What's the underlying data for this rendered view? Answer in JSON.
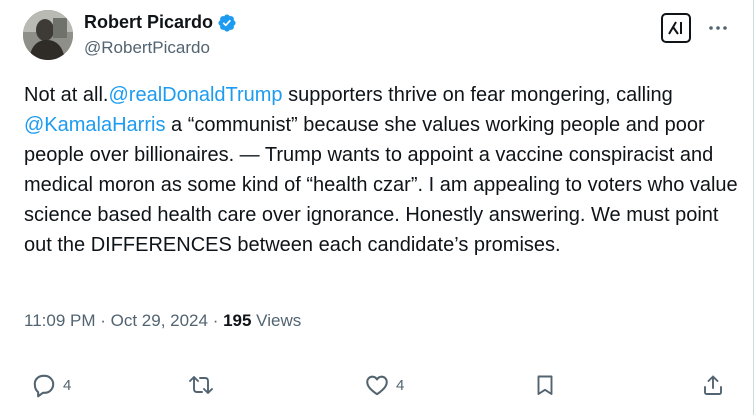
{
  "author": {
    "name": "Robert Picardo",
    "handle": "@RobertPicardo",
    "verified": true
  },
  "post": {
    "segments": [
      {
        "text": "Not at all.",
        "type": "text"
      },
      {
        "text": "@realDonaldTrump",
        "type": "mention"
      },
      {
        "text": " supporters thrive on fear mongering, calling ",
        "type": "text"
      },
      {
        "text": "@KamalaHarris",
        "type": "mention"
      },
      {
        "text": " a “communist” because she values working people and poor people over billionaires. — Trump wants to appoint a vaccine conspiracist and medical moron as some kind of “health czar”. I am appealing to voters who value science based health care over ignorance. Honestly answering. We must point out the DIFFERENCES between each candidate’s promises.",
        "type": "text"
      }
    ]
  },
  "meta": {
    "time": "11:09 PM",
    "separator": " · ",
    "date": "Oct 29, 2024",
    "views_count": "195",
    "views_label": " Views"
  },
  "actions": {
    "reply_count": "4",
    "like_count": "4"
  },
  "icons": {
    "verified": "verified-badge-icon",
    "grok": "grok-icon",
    "more": "more-icon",
    "reply": "reply-icon",
    "repost": "repost-icon",
    "like": "like-icon",
    "bookmark": "bookmark-icon",
    "share": "share-icon"
  },
  "colors": {
    "text": "#0f1419",
    "secondary": "#536471",
    "accent": "#1d9bf0"
  }
}
